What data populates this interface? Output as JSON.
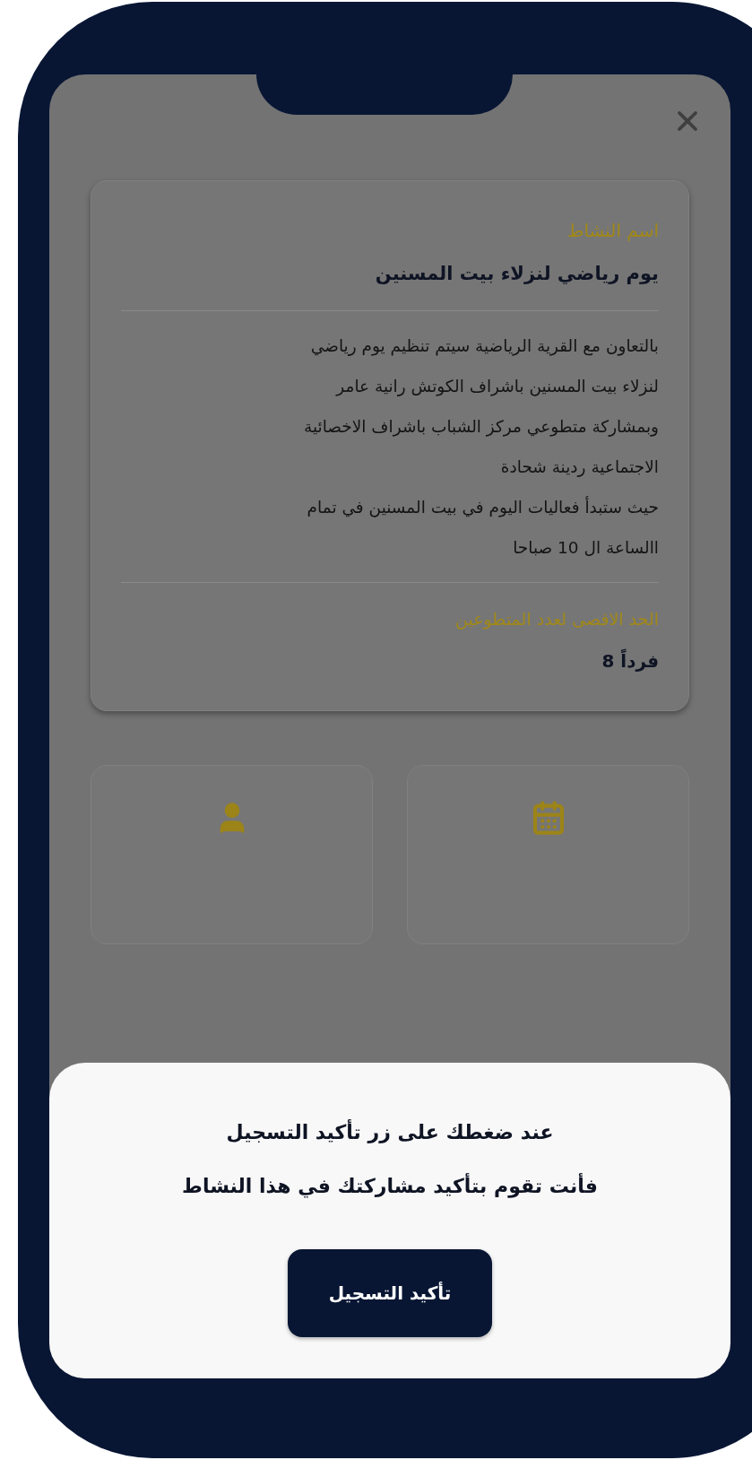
{
  "activity_card": {
    "name_label": "اسم النشاط",
    "name": "يوم رياضي لنزلاء بيت المسنين",
    "description_lines": [
      "بالتعاون مع القرية الرياضية سيتم تنظيم يوم رياضي",
      "لنزلاء بيت المسنين باشراف الكوتش رانية عامر",
      "وبمشاركة متطوعي مركز الشباب باشراف الاخصائية",
      "الاجتماعية  ردينة شحادة",
      "حيث ستبدأ فعاليات اليوم في بيت المسنين في تمام",
      "االساعة ال 10 صباحا"
    ],
    "max_label": "الحد الاقصى لعدد المتطوعين",
    "max_value": "فرداً 8"
  },
  "info_cards": [
    {
      "kind": "date"
    },
    {
      "kind": "person"
    }
  ],
  "sheet": {
    "message_lines": [
      "عند ضغطك على زر تأكيد التسجيل",
      "فأنت تقوم بتأكيد مشاركتك في هذا النشاط"
    ],
    "button": "تأكيد التسجيل"
  }
}
